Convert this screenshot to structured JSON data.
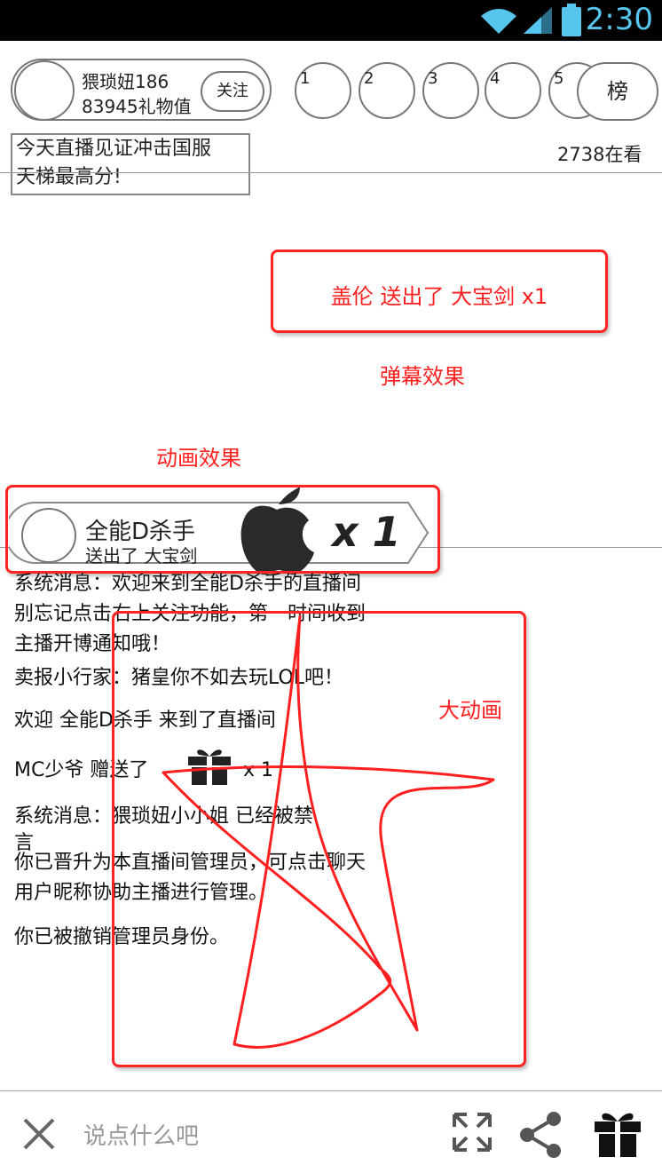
{
  "status_bar": {
    "time": "2:30"
  },
  "anchor": {
    "name": "猥琐妞186",
    "gifts": "83945礼物值",
    "follow_label": "关注"
  },
  "rank": {
    "numbers": [
      "1",
      "2",
      "3",
      "4",
      "5"
    ],
    "button_label": "榜"
  },
  "room_title": [
    "今天直播见证冲击国服",
    "天梯最高分!"
  ],
  "viewer_count": "2738在看",
  "danmaku": {
    "text": "盖伦 送出了 大宝剑 x1",
    "caption": "弹幕效果"
  },
  "animation": {
    "caption": "动画效果",
    "user": "全能D杀手",
    "action": "送出了 大宝剑",
    "multiplier": "x 1"
  },
  "big_animation_caption": "大动画",
  "chat": {
    "line1": "系统消息：欢迎来到全能D杀手的直播间",
    "line2": "别忘记点击右上关注功能，第一时间收到",
    "line3": "主播开博通知哦！",
    "line4": "卖报小行家：猪皇你不如去玩LOL吧！",
    "line5": "欢迎 全能D杀手 来到了直播间",
    "line6a": "MC少爷 赠送了",
    "line6b": "x 1",
    "line7": "系统消息：猥琐妞小小姐 已经被禁",
    "line8": "言",
    "line9": "你已晋升为本直播间管理员，可点击聊天",
    "line10": "用户昵称协助主播进行管理。",
    "line11": "你已被撤销管理员身份。"
  },
  "input": {
    "placeholder": "说点什么吧"
  },
  "icons": {
    "close": "close-icon",
    "fullscreen": "fullscreen-icon",
    "share": "share-icon",
    "gift": "gift-icon"
  },
  "colors": {
    "status_time": "#56c6ee",
    "annotation_red": "#ff1f1f"
  }
}
